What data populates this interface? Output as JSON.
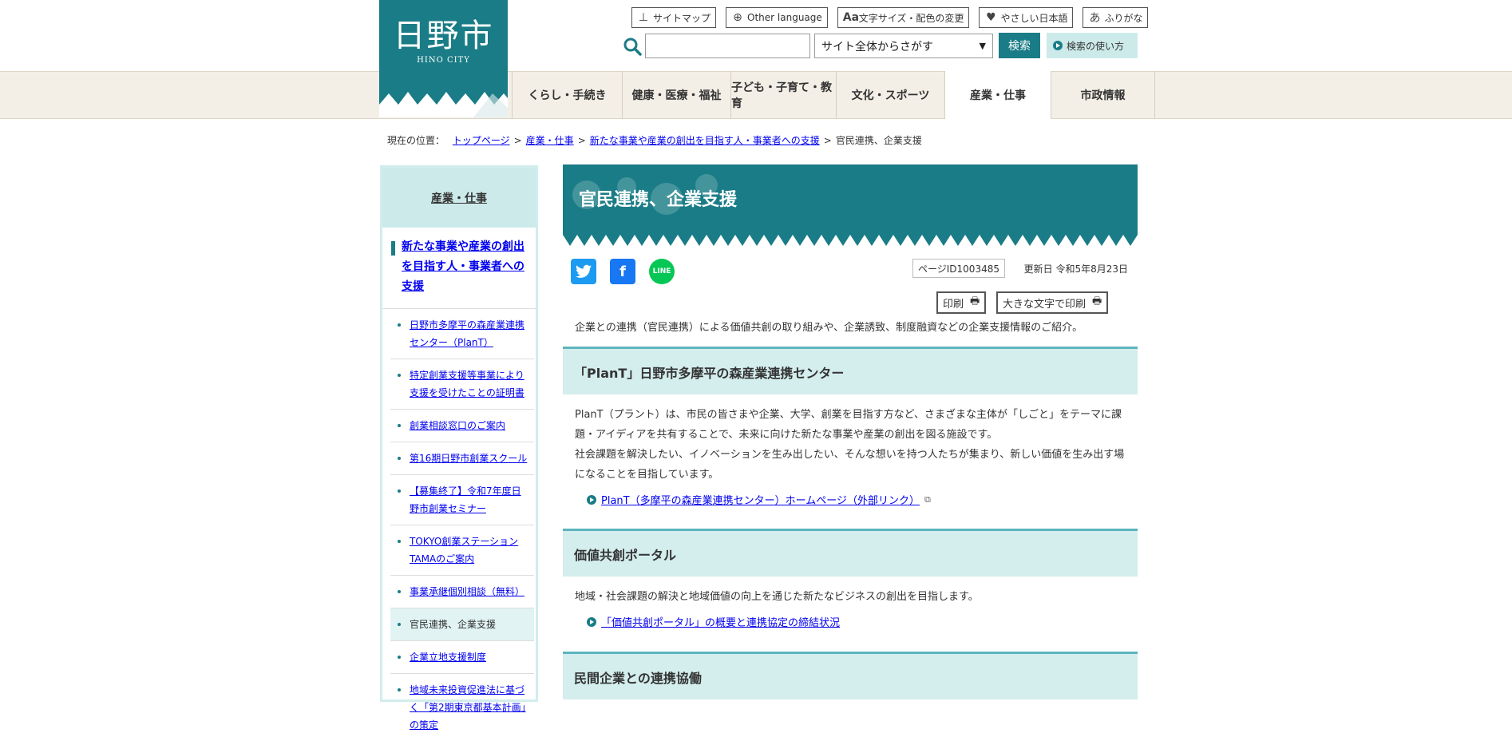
{
  "header": {
    "logo_kanji": "日野市",
    "logo_en": "HINO CITY",
    "util": [
      {
        "icon": "sitemap-icon",
        "glyph": "⊥",
        "label": "サイトマップ"
      },
      {
        "icon": "globe-icon",
        "glyph": "⊕",
        "label": "Other language"
      },
      {
        "icon": "text-size-icon",
        "glyph": "Aa",
        "label": "文字サイズ・配色の変更"
      },
      {
        "icon": "heart-icon",
        "glyph": "♥",
        "label": "やさしい日本語"
      },
      {
        "icon": "furigana-icon",
        "glyph": "あ",
        "label": "ふりがな"
      }
    ],
    "search": {
      "input_value": "",
      "select_value": "サイト全体からさがす",
      "button_label": "検索",
      "help_label": "検索の使い方"
    }
  },
  "nav": [
    {
      "label": "くらし・手続き"
    },
    {
      "label": "健康・医療・福祉"
    },
    {
      "label": "子ども・子育て・教育"
    },
    {
      "label": "文化・スポーツ"
    },
    {
      "label": "産業・仕事"
    },
    {
      "label": "市政情報"
    }
  ],
  "breadcrumb": {
    "prefix": "現在の位置：",
    "links": [
      "トップページ",
      "産業・仕事",
      "新たな事業や産業の創出を目指す人・事業者への支援"
    ],
    "current": "官民連携、企業支援"
  },
  "sidebar": {
    "heading": "産業・仕事",
    "subheading": "新たな事業や産業の創出を目指す人・事業者への支援",
    "items": [
      "日野市多摩平の森産業連携センター（PlanT）",
      "特定創業支援等事業により支援を受けたことの証明書",
      "創業相談窓口のご案内",
      "第16期日野市創業スクール",
      "【募集終了】令和7年度日野市創業セミナー",
      "TOKYO創業ステーションTAMAのご案内",
      "事業承継個別相談（無料）",
      "官民連携、企業支援",
      "企業立地支援制度",
      "地域未来投資促進法に基づく「第2期東京都基本計画」の策定"
    ]
  },
  "main": {
    "title": "官民連携、企業支援",
    "page_id": "ページID1003485",
    "updated": "更新日 令和5年8月23日",
    "print_label": "印刷",
    "print_large_label": "大きな文字で印刷",
    "lead": "企業との連携（官民連携）による価値共創の取り組みや、企業誘致、制度融資などの企業支援情報のご紹介。",
    "sections": [
      {
        "heading": "「PlanT」日野市多摩平の森産業連携センター",
        "para1": "PlanT（プラント）は、市民の皆さまや企業、大学、創業を目指す方など、さまざまな主体が「しごと」をテーマに課題・アイディアを共有することで、未来に向けた新たな事業や産業の創出を図る施設です。",
        "para2": "社会課題を解決したい、イノベーションを生み出したい、そんな想いを持つ人たちが集まり、新しい価値を生み出す場になることを目指しています。",
        "link": "PlanT（多摩平の森産業連携センター）ホームページ（外部リンク）"
      },
      {
        "heading": "価値共創ポータル",
        "para1": "地域・社会課題の解決と地域価値の向上を通じた新たなビジネスの創出を目指します。",
        "link": "「価値共創ポータル」の概要と連携協定の締結状況"
      },
      {
        "heading": "民間企業との連携協働"
      }
    ]
  },
  "colors": {
    "brand": "#1a7c86",
    "light_teal": "#cdeaea",
    "nav_bg": "#f3efe6"
  }
}
